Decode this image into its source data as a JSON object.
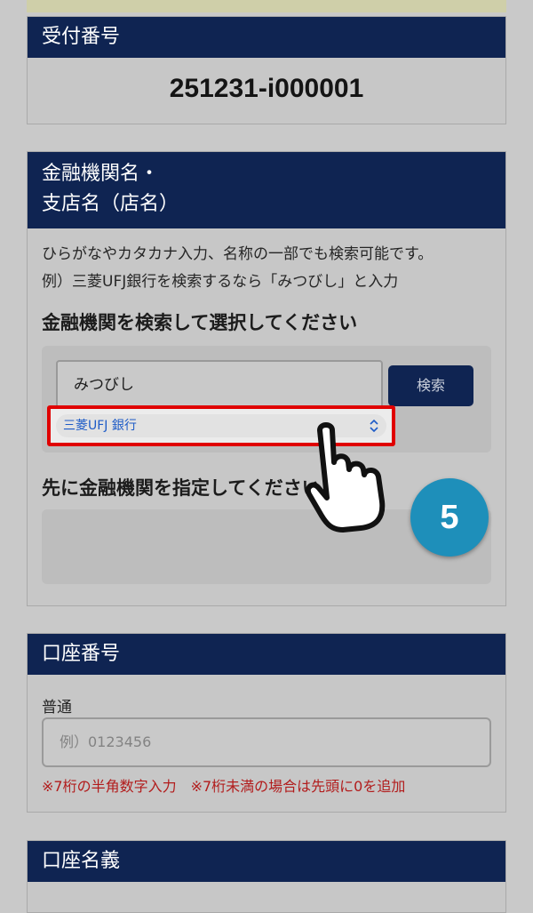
{
  "receipt": {
    "title": "受付番号",
    "number": "251231-i000001"
  },
  "bank": {
    "title_line1": "金融機関名・",
    "title_line2": "支店名（店名）",
    "hint_line1": "ひらがなやカタカナ入力、名称の一部でも検索可能です。",
    "hint_line2": "例）三菱UFJ銀行を検索するなら「みつびし」と入力",
    "search_heading": "金融機関を検索して選択してください",
    "search_value": "みつびし",
    "search_button": "検索",
    "selected_bank": "三菱UFJ 銀行",
    "branch_heading": "先に金融機関を指定してください"
  },
  "account": {
    "title": "口座番号",
    "type": "普通",
    "placeholder": "例）0123456",
    "note": "※7桁の半角数字入力　※7桁未満の場合は先頭に0を追加"
  },
  "name": {
    "title": "口座名義"
  },
  "annotation": {
    "step": "5"
  },
  "colors": {
    "header": "#0f2452",
    "highlight": "#e00000",
    "badge": "#1e8fba",
    "note": "#b21c1c"
  },
  "icons": {
    "pointer": "pointing-hand-icon",
    "select": "select-updown-icon"
  }
}
